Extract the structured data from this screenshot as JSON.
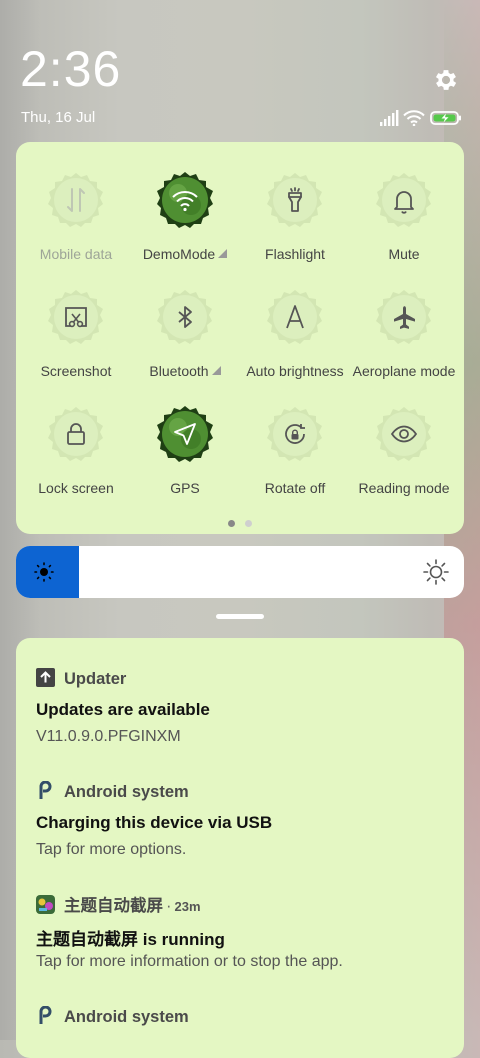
{
  "status_bar": {
    "time": "2:36",
    "date": "Thu, 16 Jul"
  },
  "quick_settings": {
    "tiles": [
      {
        "label": "Mobile data",
        "icon": "mobile-data-icon",
        "state": "disabled"
      },
      {
        "label": "DemoMode",
        "icon": "wifi-icon",
        "state": "on",
        "has_menu": true
      },
      {
        "label": "Flashlight",
        "icon": "flashlight-icon",
        "state": "off"
      },
      {
        "label": "Mute",
        "icon": "bell-icon",
        "state": "off"
      },
      {
        "label": "Screenshot",
        "icon": "scissors-icon",
        "state": "off"
      },
      {
        "label": "Bluetooth",
        "icon": "bluetooth-icon",
        "state": "off",
        "has_menu": true
      },
      {
        "label": "Auto brightness",
        "icon": "auto-brightness-icon",
        "state": "off"
      },
      {
        "label": "Aeroplane mode",
        "icon": "airplane-icon",
        "state": "off"
      },
      {
        "label": "Lock screen",
        "icon": "lock-icon",
        "state": "off"
      },
      {
        "label": "GPS",
        "icon": "location-arrow-icon",
        "state": "on"
      },
      {
        "label": "Rotate off",
        "icon": "rotation-lock-icon",
        "state": "off"
      },
      {
        "label": "Reading mode",
        "icon": "eye-icon",
        "state": "off"
      }
    ],
    "page_count": 2,
    "current_page": 1
  },
  "brightness": {
    "level": 0.14
  },
  "notifications": [
    {
      "app": "Updater",
      "age": "",
      "title": "Updates are available",
      "body": "V11.0.9.0.PFGINXM",
      "icon": "update-arrow-icon"
    },
    {
      "app": "Android system",
      "age": "",
      "title": "Charging this device via USB",
      "body": "Tap for more options.",
      "icon": "android-p-icon"
    },
    {
      "app": "主题自动截屏",
      "age": "23m",
      "title": "主题自动截屏 is running",
      "body": "Tap for more information or to stop the app.",
      "icon": "app-thumbnail-icon"
    },
    {
      "app": "Android system",
      "age": "",
      "title": "",
      "body": "",
      "icon": "android-p-icon"
    }
  ],
  "colors": {
    "panel": "#e4f7c3",
    "active_tile": "#4a8a2e",
    "brightness_fill": "#0d64d2"
  }
}
